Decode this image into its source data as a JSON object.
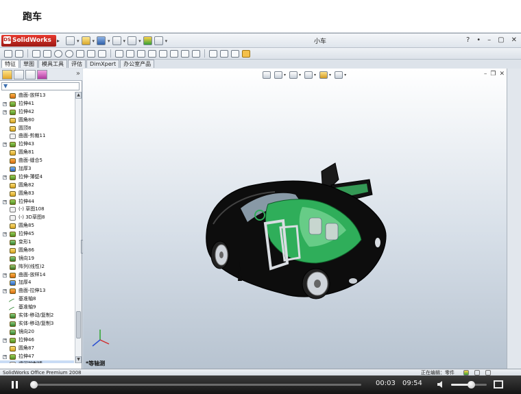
{
  "page": {
    "title": "跑车"
  },
  "window": {
    "logo_text": "SolidWorks",
    "document_title": "小车",
    "controls": [
      "?",
      "•",
      "–",
      "▢",
      "✕"
    ]
  },
  "command_tabs": [
    {
      "label": "特征",
      "active": true
    },
    {
      "label": "草图",
      "active": false
    },
    {
      "label": "模具工具",
      "active": false
    },
    {
      "label": "评估",
      "active": false
    },
    {
      "label": "DimXpert",
      "active": false
    },
    {
      "label": "办公室产品",
      "active": false
    }
  ],
  "panel": {
    "expand_symbol": "»"
  },
  "tree": [
    {
      "label": "曲面-放样13",
      "icon": "surf",
      "expand": false
    },
    {
      "label": "拉伸41",
      "icon": "ext",
      "expand": true
    },
    {
      "label": "拉伸42",
      "icon": "ext",
      "expand": true
    },
    {
      "label": "圆角80",
      "icon": "fil",
      "expand": false
    },
    {
      "label": "圆顶8",
      "icon": "fil",
      "expand": false
    },
    {
      "label": "曲面-剪裁11",
      "icon": "sketch",
      "expand": false
    },
    {
      "label": "拉伸43",
      "icon": "ext",
      "expand": true
    },
    {
      "label": "圆角81",
      "icon": "fil",
      "expand": false
    },
    {
      "label": "曲面-缝合5",
      "icon": "surf",
      "expand": false
    },
    {
      "label": "加厚3",
      "icon": "thick",
      "expand": false
    },
    {
      "label": "拉伸-薄壁4",
      "icon": "ext",
      "expand": true
    },
    {
      "label": "圆角82",
      "icon": "fil",
      "expand": false
    },
    {
      "label": "圆角83",
      "icon": "fil",
      "expand": false
    },
    {
      "label": "拉伸44",
      "icon": "ext",
      "expand": true
    },
    {
      "label": "(-) 草图108",
      "icon": "sketch",
      "expand": false
    },
    {
      "label": "(-) 3D草图8",
      "icon": "sketch",
      "expand": false
    },
    {
      "label": "圆角85",
      "icon": "fil",
      "expand": false
    },
    {
      "label": "拉伸45",
      "icon": "ext",
      "expand": true
    },
    {
      "label": "变形1",
      "icon": "mirror",
      "expand": false
    },
    {
      "label": "圆角86",
      "icon": "fil",
      "expand": false
    },
    {
      "label": "镜向19",
      "icon": "mirror",
      "expand": false
    },
    {
      "label": "阵列(线性)2",
      "icon": "pattern",
      "expand": false
    },
    {
      "label": "曲面-放样14",
      "icon": "surf",
      "expand": true
    },
    {
      "label": "加厚4",
      "icon": "thick",
      "expand": false
    },
    {
      "label": "曲面-拉伸13",
      "icon": "surf",
      "expand": true
    },
    {
      "label": "基准轴8",
      "icon": "axis",
      "expand": false
    },
    {
      "label": "基准轴9",
      "icon": "axis",
      "expand": false
    },
    {
      "label": "实体-移动/复制2",
      "icon": "mirror",
      "expand": false
    },
    {
      "label": "实体-移动/复制3",
      "icon": "mirror",
      "expand": false
    },
    {
      "label": "镜向20",
      "icon": "mirror",
      "expand": false
    },
    {
      "label": "拉伸46",
      "icon": "ext",
      "expand": true
    },
    {
      "label": "圆角87",
      "icon": "fil",
      "expand": false
    },
    {
      "label": "拉伸47",
      "icon": "ext",
      "expand": true
    },
    {
      "label": "退回控制棒",
      "icon": "sketch",
      "expand": false,
      "selected": true
    }
  ],
  "viewport": {
    "view_label": "*等轴测"
  },
  "status": {
    "product": "SolidWorks Office Premium 2008",
    "editing": "正在编辑：零件"
  },
  "player": {
    "current_time": "00:03",
    "total_time": "09:54",
    "progress": 0.005,
    "volume": 0.55
  },
  "colors": {
    "car_body": "#0d0d0d",
    "car_glass": "#2fae5a",
    "viewport_top": "#ffffff",
    "viewport_bottom": "#b7c3d0"
  }
}
